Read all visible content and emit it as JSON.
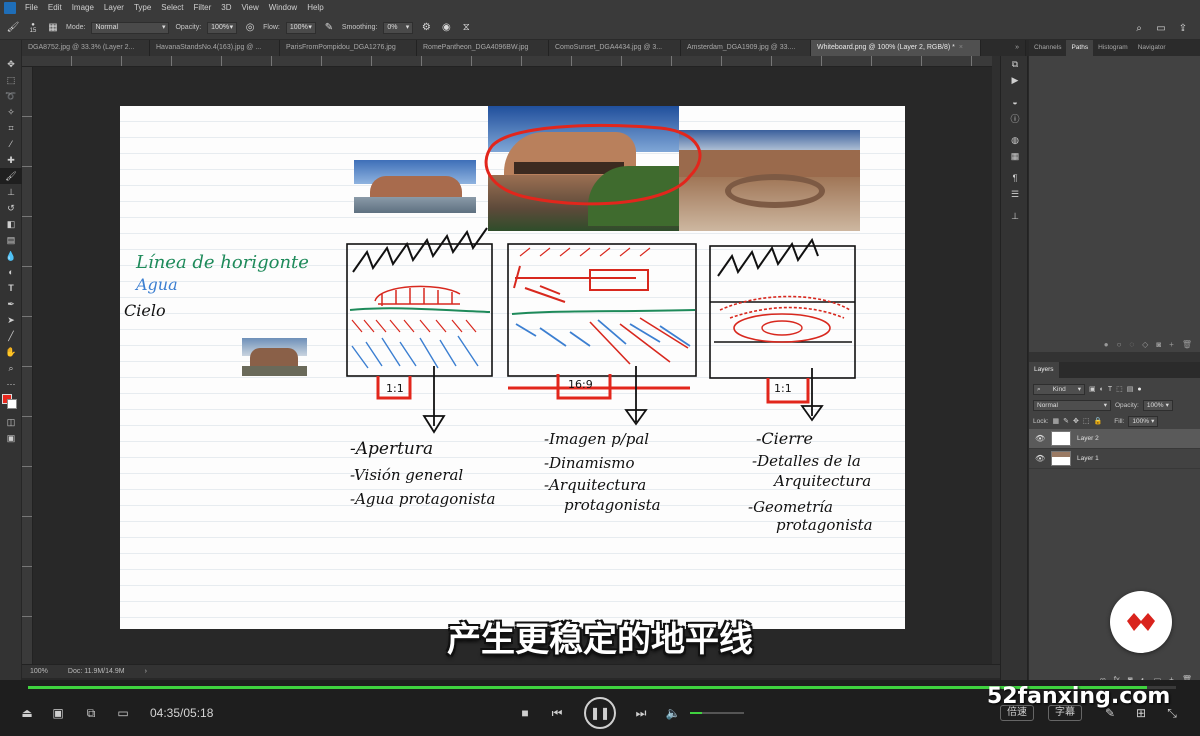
{
  "menu": [
    "File",
    "Edit",
    "Image",
    "Layer",
    "Type",
    "Select",
    "Filter",
    "3D",
    "View",
    "Window",
    "Help"
  ],
  "options": {
    "brush_size": "15",
    "mode_label": "Mode:",
    "mode_value": "Normal",
    "opacity_label": "Opacity:",
    "opacity_value": "100%",
    "flow_label": "Flow:",
    "flow_value": "100%",
    "smoothing_label": "Smoothing:",
    "smoothing_value": "0%"
  },
  "doc_tabs": [
    {
      "label": "DGA8752.jpg @ 33.3% (Layer 2...",
      "active": false
    },
    {
      "label": "HavanaStandsNo.4(163).jpg @ ...",
      "active": false
    },
    {
      "label": "ParisFromPompidou_DGA1276.jpg",
      "active": false
    },
    {
      "label": "RomePantheon_DGA4096BW.jpg",
      "active": false
    },
    {
      "label": "ComoSunset_DGA4434.jpg @ 3...",
      "active": false
    },
    {
      "label": "Amsterdam_DGA1909.jpg @ 33....",
      "active": false
    },
    {
      "label": "Whiteboard.png @ 100% (Layer 2, RGB/8) *",
      "active": true
    }
  ],
  "status": {
    "zoom": "100%",
    "doc": "Doc: 11.9M/14.9M"
  },
  "panels": {
    "tabs": [
      "Channels",
      "Paths",
      "Histogram",
      "Navigator"
    ],
    "active_tab": "Paths",
    "layers_title": "Layers",
    "kind_label": "Kind",
    "blend_mode": "Normal",
    "opacity_label": "Opacity:",
    "opacity_value": "100%",
    "lock_label": "Lock:",
    "fill_label": "Fill:",
    "fill_value": "100%",
    "layers": [
      {
        "name": "Layer 2",
        "selected": true
      },
      {
        "name": "Layer 1",
        "selected": false
      }
    ]
  },
  "player": {
    "time": "04:35/05:18",
    "progress": 0.975,
    "volume": 0.22,
    "speed_label": "倍速",
    "caption_label": "字幕"
  },
  "subtitle": "产生更稳定的地平线",
  "watermark": "52fanxing.com",
  "colors": {
    "accent": "#3fd23f",
    "foreground_swatch": "#e8281e",
    "brand_red": "#d9231c"
  },
  "whiteboard": {
    "legend": [
      "Línea de horigonte",
      "Agua",
      "Cielo"
    ],
    "ratios": [
      "1:1",
      "16:9",
      "1:1"
    ],
    "notes": [
      [
        "-Apertura",
        "-Visión general",
        "-Agua protagonista"
      ],
      [
        "-Imagen p/pal",
        "-Dinamismo",
        "-Arquitectura",
        "protagonista"
      ],
      [
        "-Cierre",
        "-Detalles de la",
        "Arquitectura",
        "-Geometría",
        "protagonista"
      ]
    ]
  }
}
